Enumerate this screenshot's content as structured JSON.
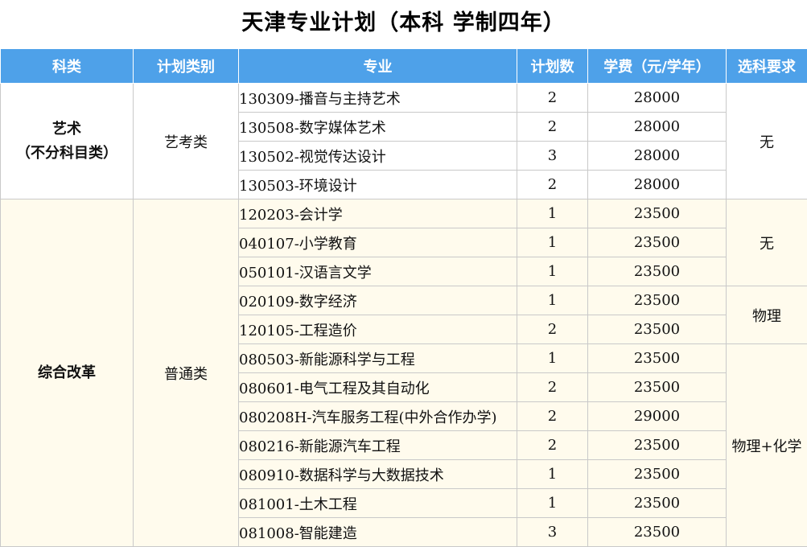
{
  "title": "天津专业计划（本科 学制四年）",
  "headers": [
    "科类",
    "计划类别",
    "专业",
    "计划数",
    "学费（元/学年）",
    "选科要求"
  ],
  "art": {
    "category_line1": "艺术",
    "category_line2": "（不分科目类）",
    "plan_type": "艺考类",
    "requirement": "无",
    "rows": [
      {
        "major": "130309-播音与主持艺术",
        "count": "2",
        "fee": "28000"
      },
      {
        "major": "130508-数字媒体艺术",
        "count": "2",
        "fee": "28000"
      },
      {
        "major": "130502-视觉传达设计",
        "count": "3",
        "fee": "28000"
      },
      {
        "major": "130503-环境设计",
        "count": "2",
        "fee": "28000"
      }
    ]
  },
  "reform": {
    "category": "综合改革",
    "plan_type": "普通类",
    "requirements": [
      "无",
      "物理",
      "物理+化学"
    ],
    "rows": [
      {
        "major": "120203-会计学",
        "count": "1",
        "fee": "23500"
      },
      {
        "major": "040107-小学教育",
        "count": "1",
        "fee": "23500"
      },
      {
        "major": "050101-汉语言文学",
        "count": "1",
        "fee": "23500"
      },
      {
        "major": "020109-数字经济",
        "count": "1",
        "fee": "23500"
      },
      {
        "major": "120105-工程造价",
        "count": "2",
        "fee": "23500"
      },
      {
        "major": "080503-新能源科学与工程",
        "count": "1",
        "fee": "23500"
      },
      {
        "major": "080601-电气工程及其自动化",
        "count": "2",
        "fee": "23500"
      },
      {
        "major": "080208H-汽车服务工程(中外合作办学)",
        "count": "2",
        "fee": "29000"
      },
      {
        "major": "080216-新能源汽车工程",
        "count": "2",
        "fee": "23500"
      },
      {
        "major": "080910-数据科学与大数据技术",
        "count": "1",
        "fee": "23500"
      },
      {
        "major": "081001-土木工程",
        "count": "1",
        "fee": "23500"
      },
      {
        "major": "081008-智能建造",
        "count": "3",
        "fee": "23500"
      }
    ]
  },
  "colors": {
    "header_bg": "#4ea1e9",
    "reform_bg": "#fffbed"
  }
}
